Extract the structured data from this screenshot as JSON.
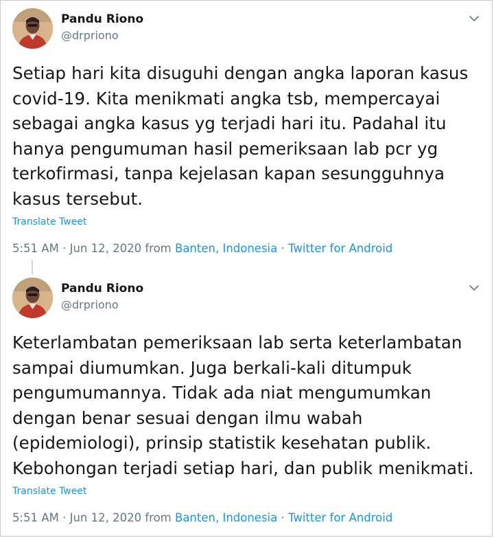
{
  "tweets": [
    {
      "author": {
        "name": "Pandu Riono",
        "handle": "@drpriono"
      },
      "text": "Setiap hari kita disuguhi dengan angka laporan kasus\ncovid-19. Kita menikmati angka tsb, mempercayai\nsebagai angka kasus yg terjadi hari itu. Padahal itu\nhanya pengumuman hasil pemeriksaan lab pcr yg\nterkofirmasi, tanpa kejelasan kapan sesungguhnya\nkasus tersebut.",
      "translate_label": "Translate Tweet",
      "time": "5:51 AM",
      "separator": "·",
      "date": "Jun 12, 2020",
      "from_label": "from",
      "location": "Banten, Indonesia",
      "source": "Twitter for Android"
    },
    {
      "author": {
        "name": "Pandu Riono",
        "handle": "@drpriono"
      },
      "text": "Keterlambatan pemeriksaan lab serta keterlambatan\nsampai diumumkan. Juga berkali-kali ditumpuk\npengumumannya. Tidak ada niat mengumumkan\ndengan benar sesuai dengan ilmu wabah\n(epidemiologi), prinsip statistik kesehatan publik.\nKebohongan terjadi setiap hari, dan publik menikmati.",
      "translate_label": "Translate Tweet",
      "time": "5:51 AM",
      "separator": "·",
      "date": "Jun 12, 2020",
      "from_label": "from",
      "location": "Banten, Indonesia",
      "source": "Twitter for Android"
    }
  ],
  "icons": {
    "caret": "chevron-down-icon",
    "avatar": "profile-photo"
  },
  "colors": {
    "link": "#1b95e0",
    "secondary_text": "#657786",
    "primary_text": "#14171a",
    "thread_line": "#ccd6dd"
  }
}
